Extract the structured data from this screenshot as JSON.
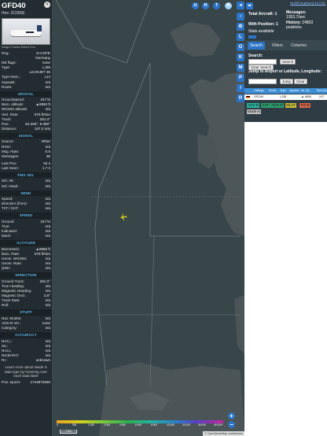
{
  "info": {
    "callsign": "GFD40",
    "hex_label": "Hex:",
    "hex": "3C065E",
    "close_glyph": "×",
    "photo_credit": "Image © Aaron Esben Krul",
    "rows_a": [
      {
        "k": "Reg.:",
        "v": "D-CGFE"
      },
      {
        "k": "",
        "v": "Germany"
      },
      {
        "k": "DB flags:",
        "v": "none"
      },
      {
        "k": "Type:",
        "v": "LJ35"
      },
      {
        "k": "",
        "v": "LEARJET 35"
      },
      {
        "k": "Type Desc.:",
        "v": "L2J"
      },
      {
        "k": "Squawk:",
        "v": "n/a"
      },
      {
        "k": "Route:",
        "v": "n/a"
      }
    ],
    "spatial_title": "SPATIAL",
    "spatial": [
      {
        "k": "Groundspeed:",
        "v": "247 kt"
      },
      {
        "k": "Baro. altitude:",
        "v": "▲8950 ft"
      },
      {
        "k": "WGS84 altitude:",
        "v": "n/a"
      },
      {
        "k": "Vert. Rate:",
        "v": "576 ft/min"
      },
      {
        "k": "Track:",
        "v": "261.0°"
      },
      {
        "k": "Pos.:",
        "v": "54.206°, 8.390°"
      },
      {
        "k": "Distance:",
        "v": "107.2 nmi"
      }
    ],
    "signal_title": "SIGNAL",
    "signal": [
      {
        "k": "Source:",
        "v": "Other"
      },
      {
        "k": "RSSI:",
        "v": "n/a"
      },
      {
        "k": "Msg. Rate:",
        "v": "0.5"
      },
      {
        "k": "Messages:",
        "v": "38"
      }
    ],
    "signal2": [
      {
        "k": "Last Pos.:",
        "v": "54 s"
      },
      {
        "k": "Last Seen:",
        "v": "1.7 s"
      }
    ],
    "fms_title": "FMS SEL",
    "fms": [
      {
        "k": "Sel. Alt.:",
        "v": "n/a"
      },
      {
        "k": "Sel. Head.:",
        "v": "n/a"
      }
    ],
    "wind_title": "WIND",
    "wind": [
      {
        "k": "Speed:",
        "v": "n/a"
      },
      {
        "k": "Direction (from):",
        "v": "n/a"
      },
      {
        "k": "TAT / OAT:",
        "v": "n/a"
      }
    ],
    "speed_title": "SPEED",
    "speed": [
      {
        "k": "Ground:",
        "v": "247 kt"
      },
      {
        "k": "True:",
        "v": "n/a"
      },
      {
        "k": "Indicated:",
        "v": "n/a"
      },
      {
        "k": "Mach:",
        "v": "n/a"
      }
    ],
    "altitude_title": "ALTITUDE",
    "altitude": [
      {
        "k": "Barometric:",
        "v": "▲8950 ft"
      },
      {
        "k": "Baro. Rate:",
        "v": "576 ft/min"
      },
      {
        "k": "Geom. WGS84:",
        "v": "n/a"
      },
      {
        "k": "Geom. Rate:",
        "v": "n/a"
      },
      {
        "k": "QNH:",
        "v": "n/a"
      }
    ],
    "direction_title": "DIRECTION",
    "direction": [
      {
        "k": "Ground Track:",
        "v": "261.0°"
      },
      {
        "k": "True Heading:",
        "v": "n/a"
      },
      {
        "k": "Magnetic Heading:",
        "v": "n/a"
      },
      {
        "k": "Magnetic Decl.:",
        "v": "3.8°"
      },
      {
        "k": "Track Rate:",
        "v": "n/a"
      },
      {
        "k": "Roll:",
        "v": "n/a"
      }
    ],
    "stuff_title": "STUFF",
    "stuff": [
      {
        "k": "Nav. Modes:",
        "v": "n/a"
      },
      {
        "k": "ADS-B Ver.:",
        "v": "none"
      },
      {
        "k": "Category:",
        "v": "n/a"
      }
    ],
    "accuracy_title": "ACCURACY",
    "accuracy": [
      {
        "k": "NACₚ:",
        "v": "n/a"
      },
      {
        "k": "SIL:",
        "v": "n/a"
      },
      {
        "k": "NACᵥ:",
        "v": "n/a"
      },
      {
        "k": "NICBARO:",
        "v": "n/a"
      },
      {
        "k": "Rc:",
        "v": "unknown"
      }
    ],
    "note": "Learn more about Mode S data type by hovering over each data label",
    "pos_epoch_label": "Pos. epoch:",
    "pos_epoch": "1744872846"
  },
  "map": {
    "top_buttons": [
      "U",
      "H",
      "T"
    ],
    "side_buttons": [
      "L",
      "O",
      "K",
      "M",
      "P",
      "I",
      "R"
    ],
    "zoom_in": "+",
    "zoom_out": "−",
    "legend_labels": [
      "0",
      "500",
      "1 000",
      "2 000",
      "4 000",
      "6 000",
      "8 000",
      "10 000",
      "20 000",
      "30 000",
      "40 000+"
    ],
    "scale_label": "1 NM",
    "attribution": "© OpenStreetMap contributors"
  },
  "right": {
    "link": "tar1090 on github (3.14.1701)",
    "total_label": "Total Aircraft:",
    "total": "1",
    "messages_label": "Messages:",
    "messages": "1353.7/sec",
    "withpos_label": "With Position:",
    "withpos": "1",
    "history_label": "History:",
    "history": "24803 positions",
    "stats": "Stats available",
    "tabs": [
      "Search",
      "Filters",
      "Columns"
    ],
    "search_label": "Search:",
    "search_btn": "Search",
    "clear_search": "Clear Search",
    "jump_label": "Jump to Airport or Latitude, Longitude:",
    "jump_btn": "Jump",
    "clear_btn": "Clear",
    "columns": [
      "Callsign",
      "Route",
      "Type",
      "Squawk",
      "Alt. (ft)",
      "Spd (kt)"
    ],
    "row": {
      "callsign": "GFD40",
      "type": "LJ35",
      "alt": "▲ 8950",
      "spd": "247"
    },
    "sources": [
      "ADS-B",
      "UAT / ADS-R",
      "MLAT",
      "TIS-B",
      "Mode-S"
    ]
  },
  "colors": {
    "accent": "#2d74c6",
    "section_title": "#5fb4e6",
    "sea": "#384549",
    "land": "#4b5558",
    "adsb": "#2bb5a1",
    "uat": "#2e9f6b",
    "mlat": "#c9bb3a",
    "tisb": "#d8664a",
    "modes": "#bdbdbd"
  }
}
